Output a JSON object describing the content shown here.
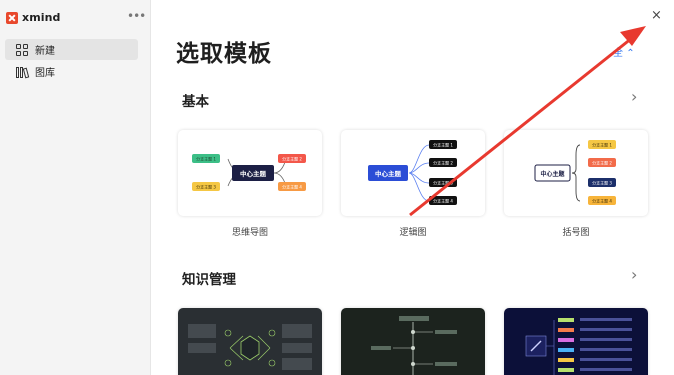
{
  "brand": {
    "name": "xmind",
    "more": "•••"
  },
  "sidebar": {
    "items": [
      {
        "label": "新建",
        "icon": "grid-icon",
        "active": true
      },
      {
        "label": "图库",
        "icon": "library-icon",
        "active": false
      }
    ]
  },
  "main": {
    "title": "选取模板",
    "close": "×",
    "language": "全",
    "sections": [
      {
        "title": "基本",
        "cards": [
          {
            "label": "思维导图",
            "center": "中心主题",
            "topics": [
              "分支主题 1",
              "分支主题 2",
              "分支主题 3",
              "分支主题 4"
            ]
          },
          {
            "label": "逻辑图",
            "center": "中心主题",
            "topics": [
              "分支主题 1",
              "分支主题 2",
              "分支主题 3",
              "分支主题 4"
            ]
          },
          {
            "label": "括号图",
            "center": "中心主题",
            "topics": [
              "分支主题 1",
              "分支主题 2",
              "分支主题 3",
              "分支主题 4"
            ]
          }
        ]
      },
      {
        "title": "知识管理"
      }
    ]
  },
  "colors": {
    "accent": "#3477f0",
    "brand": "#e8482c",
    "arrow": "#e8392f",
    "center_dark": "#1c1f45",
    "center_blue": "#2b4dd6"
  }
}
